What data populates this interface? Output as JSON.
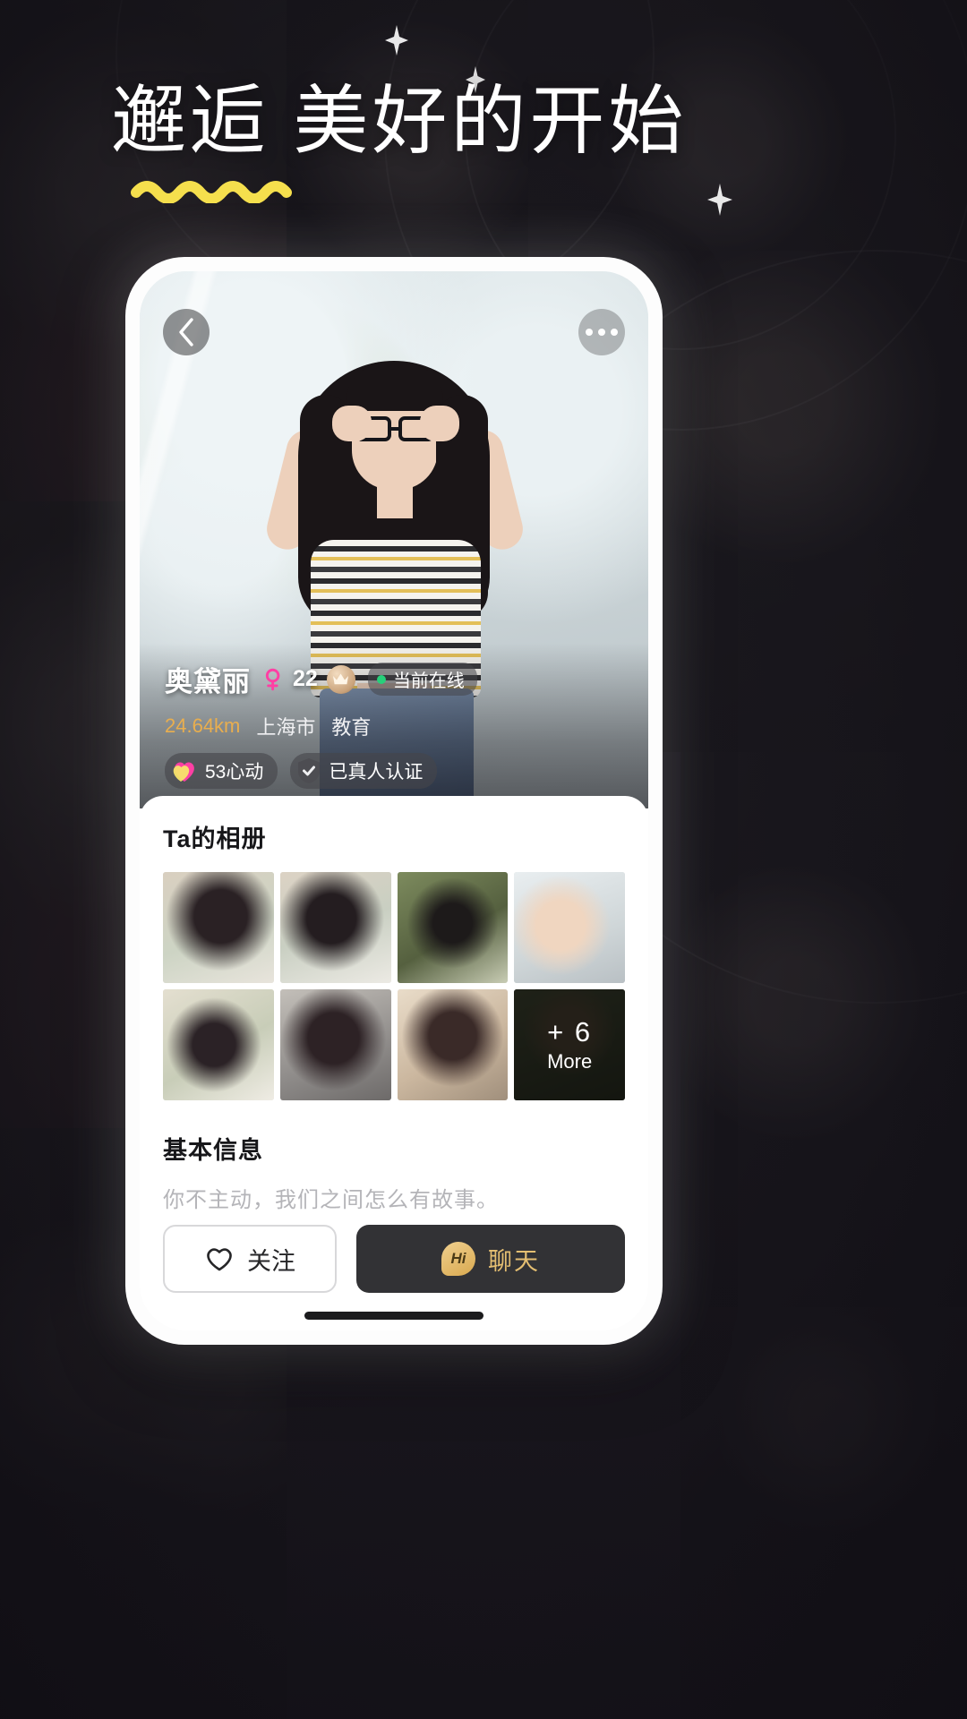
{
  "hero_banner": {
    "headline": "邂逅 美好的开始",
    "underline_color": "#f5df4d"
  },
  "phone": {
    "topbar": {
      "back_icon": "chevron-left-icon",
      "more_icon": "more-horizontal-icon"
    },
    "profile": {
      "name": "奥黛丽",
      "gender_icon": "female-gender-icon",
      "gender_color": "#ff3fa4",
      "age": "22",
      "crown_icon": "crown-icon",
      "online_label": "当前在线",
      "online_dot_color": "#27d07a",
      "distance": "24.64km",
      "distance_color": "#e9ae4e",
      "city": "上海市",
      "occupation": "教育",
      "like_chip": {
        "icon": "heart-badge-icon",
        "label": "53心动"
      },
      "verify_chip": {
        "icon": "shield-check-icon",
        "label": "已真人认证"
      }
    },
    "album": {
      "title": "Ta的相册",
      "tiles": [
        {
          "id": "photo-1",
          "overlay": null
        },
        {
          "id": "photo-2",
          "overlay": null
        },
        {
          "id": "photo-3",
          "overlay": null
        },
        {
          "id": "photo-4",
          "overlay": null
        },
        {
          "id": "photo-5",
          "overlay": null
        },
        {
          "id": "photo-6",
          "overlay": null
        },
        {
          "id": "photo-7",
          "overlay": null
        },
        {
          "id": "photo-8",
          "overlay": {
            "count": "+ 6",
            "label": "More"
          }
        }
      ]
    },
    "basic_info": {
      "title": "基本信息",
      "bio": "你不主动，我们之间怎么有故事。",
      "tags": [
        "",
        "",
        ""
      ]
    },
    "actions": {
      "follow": {
        "icon": "heart-outline-icon",
        "label": "关注"
      },
      "chat": {
        "icon": "hi-bubble-icon",
        "icon_text": "Hi",
        "label": "聊天",
        "label_color": "#e5bf72",
        "background": "#323235"
      }
    }
  }
}
